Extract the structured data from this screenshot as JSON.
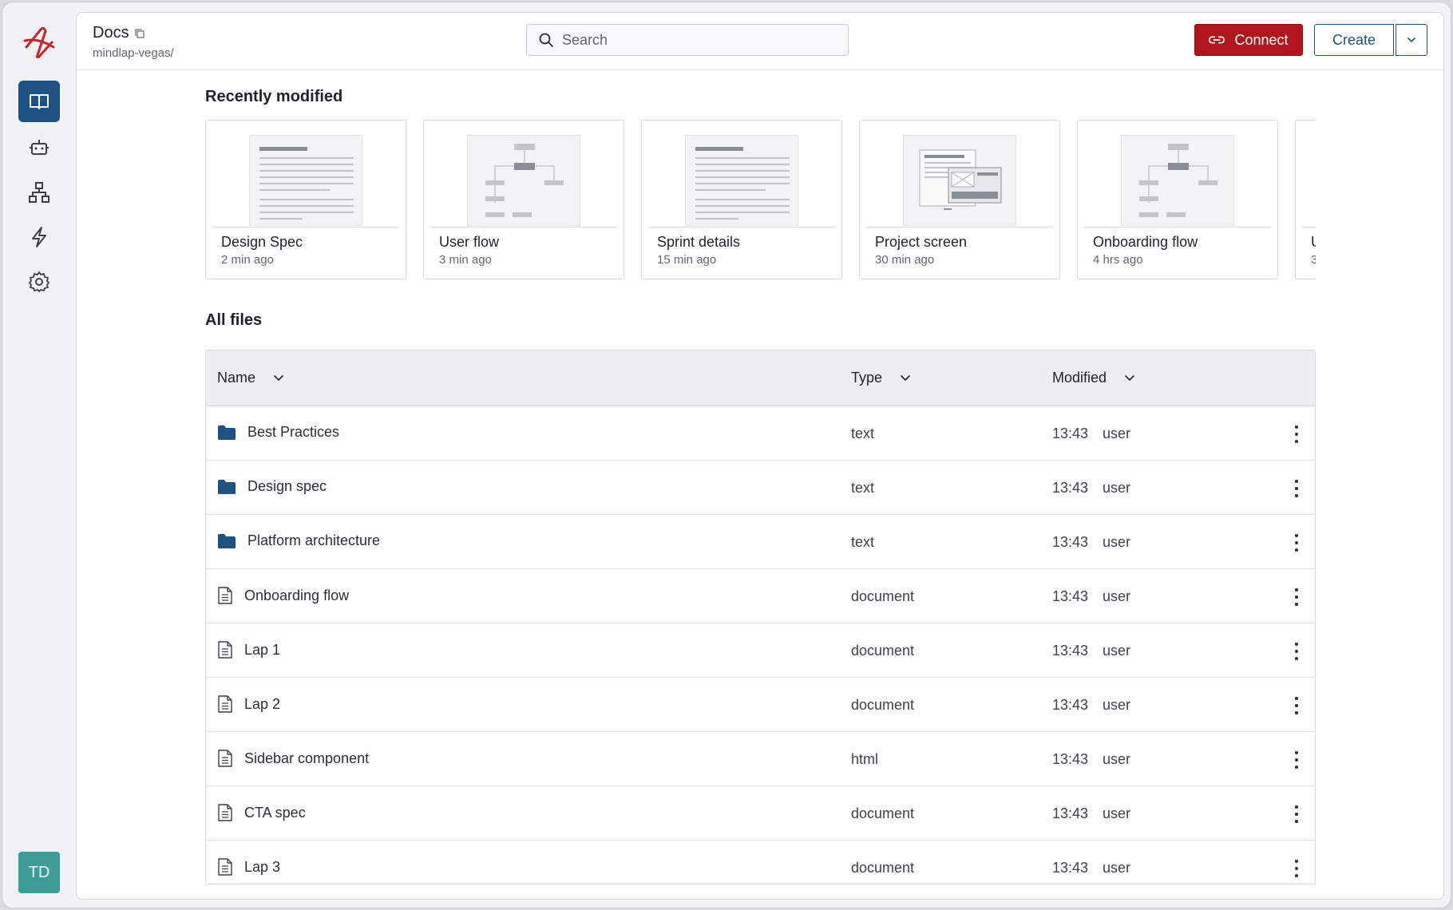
{
  "colors": {
    "accent": "#1e5282",
    "danger": "#b0161b",
    "avatar": "#3e9c97",
    "brand": "#c8262a"
  },
  "rail": {
    "items": [
      {
        "name": "docs",
        "icon": "book-icon",
        "active": true
      },
      {
        "name": "bots",
        "icon": "robot-icon",
        "active": false
      },
      {
        "name": "structure",
        "icon": "hierarchy-icon",
        "active": false
      },
      {
        "name": "automations",
        "icon": "lightning-icon",
        "active": false
      },
      {
        "name": "settings",
        "icon": "gear-icon",
        "active": false
      }
    ],
    "avatar_initials": "TD"
  },
  "header": {
    "title": "Docs",
    "path": "mindlap-vegas/",
    "search_placeholder": "Search",
    "connect_label": "Connect",
    "create_label": "Create"
  },
  "recent": {
    "title": "Recently modified",
    "cards": [
      {
        "name": "Design Spec",
        "time": "2 min ago",
        "thumb": "document"
      },
      {
        "name": "User flow",
        "time": "3 min ago",
        "thumb": "flow"
      },
      {
        "name": "Sprint details",
        "time": "15 min ago",
        "thumb": "document"
      },
      {
        "name": "Project screen",
        "time": "30 min ago",
        "thumb": "screen"
      },
      {
        "name": "Onboarding flow",
        "time": "4 hrs ago",
        "thumb": "flow"
      },
      {
        "name": "U",
        "time": "3",
        "thumb": "document"
      }
    ]
  },
  "files": {
    "title": "All files",
    "columns": {
      "name": "Name",
      "type": "Type",
      "modified": "Modified"
    },
    "rows": [
      {
        "name": "Best Practices",
        "kind": "folder",
        "type": "text",
        "time": "13:43",
        "user": "user"
      },
      {
        "name": "Design spec",
        "kind": "folder",
        "type": "text",
        "time": "13:43",
        "user": "user"
      },
      {
        "name": "Platform architecture",
        "kind": "folder",
        "type": "text",
        "time": "13:43",
        "user": "user"
      },
      {
        "name": "Onboarding flow",
        "kind": "file",
        "type": "document",
        "time": "13:43",
        "user": "user"
      },
      {
        "name": "Lap 1",
        "kind": "file",
        "type": "document",
        "time": "13:43",
        "user": "user"
      },
      {
        "name": "Lap 2",
        "kind": "file",
        "type": "document",
        "time": "13:43",
        "user": "user"
      },
      {
        "name": "Sidebar component",
        "kind": "file",
        "type": "html",
        "time": "13:43",
        "user": "user"
      },
      {
        "name": "CTA spec",
        "kind": "file",
        "type": "document",
        "time": "13:43",
        "user": "user"
      },
      {
        "name": "Lap 3",
        "kind": "file",
        "type": "document",
        "time": "13:43",
        "user": "user"
      }
    ]
  }
}
